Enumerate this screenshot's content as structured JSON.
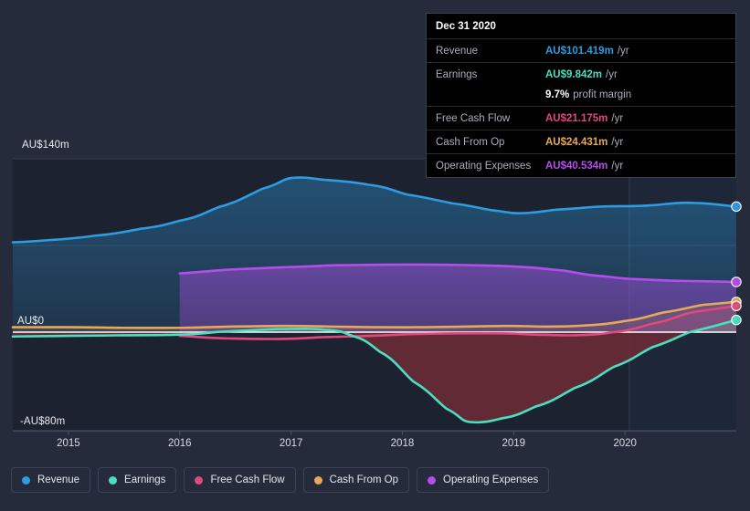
{
  "chart_data": {
    "type": "area",
    "title": "",
    "xlabel": "",
    "ylabel": "",
    "currency": "AU$",
    "grid": true,
    "legend_position": "bottom",
    "x_tick_labels": [
      "2015",
      "2016",
      "2017",
      "2018",
      "2019",
      "2020"
    ],
    "y_tick_labels": [
      "AU$140m",
      "AU$0",
      "-AU$80m"
    ],
    "ylim": [
      -80,
      140
    ],
    "xlim": [
      2014.5,
      2021.0
    ],
    "series": [
      {
        "name": "Revenue",
        "color": "#2e9ce0",
        "x": [
          2014.5,
          2014.85,
          2015.25,
          2015.65,
          2016.0,
          2016.35,
          2016.75,
          2017.0,
          2017.3,
          2017.7,
          2018.05,
          2018.45,
          2018.8,
          2019.05,
          2019.4,
          2019.8,
          2020.15,
          2020.55,
          2021.0
        ],
        "values": [
          72.5,
          74.5,
          78.0,
          83.5,
          90.0,
          101.0,
          116.0,
          124.5,
          123.0,
          119.0,
          111.0,
          104.0,
          98.5,
          96.0,
          99.0,
          101.5,
          102.0,
          104.5,
          101.419
        ]
      },
      {
        "name": "Earnings",
        "color": "#4adfc0",
        "x": [
          2014.5,
          2015.0,
          2015.5,
          2016.0,
          2016.4,
          2016.9,
          2017.3,
          2017.55,
          2017.8,
          2018.1,
          2018.4,
          2018.6,
          2018.9,
          2019.2,
          2019.55,
          2019.9,
          2020.25,
          2020.6,
          2021.0
        ],
        "values": [
          -3.5,
          -3.0,
          -2.5,
          -2.0,
          0.5,
          2.5,
          2.0,
          -3.0,
          -16.0,
          -40.0,
          -62.0,
          -72.5,
          -69.5,
          -60.0,
          -45.0,
          -28.0,
          -12.0,
          0.5,
          9.842
        ]
      },
      {
        "name": "Free Cash Flow",
        "color": "#e0487e",
        "x": [
          2016.0,
          2016.4,
          2016.9,
          2017.3,
          2017.7,
          2018.1,
          2018.5,
          2018.9,
          2019.2,
          2019.55,
          2019.9,
          2020.25,
          2020.6,
          2021.0
        ],
        "values": [
          -3.0,
          -5.0,
          -5.5,
          -4.0,
          -3.0,
          -1.5,
          -1.0,
          -1.0,
          -2.0,
          -2.5,
          0.0,
          7.0,
          16.0,
          21.175
        ]
      },
      {
        "name": "Cash From Op",
        "color": "#e8a855",
        "x": [
          2014.5,
          2015.0,
          2015.5,
          2016.0,
          2016.45,
          2016.95,
          2017.35,
          2017.75,
          2018.15,
          2018.55,
          2018.95,
          2019.3,
          2019.65,
          2020.0,
          2020.35,
          2020.7,
          2021.0
        ],
        "values": [
          4.0,
          4.0,
          3.5,
          3.5,
          4.5,
          5.0,
          4.5,
          4.0,
          4.0,
          4.5,
          5.0,
          4.5,
          5.5,
          9.0,
          16.0,
          22.0,
          24.431
        ]
      },
      {
        "name": "Operating Expenses",
        "color": "#b44dea",
        "x": [
          2016.0,
          2016.45,
          2016.95,
          2017.4,
          2017.85,
          2018.25,
          2018.65,
          2019.0,
          2019.35,
          2019.7,
          2020.05,
          2020.45,
          2020.75,
          2021.0
        ],
        "values": [
          47.5,
          50.5,
          52.5,
          54.0,
          54.5,
          54.5,
          54.0,
          53.0,
          50.5,
          46.0,
          43.0,
          41.5,
          41.0,
          40.534
        ]
      }
    ]
  },
  "tooltip": {
    "title": "Dec 31 2020",
    "rows": [
      {
        "key": "Revenue",
        "value": "AU$101.419m",
        "suffix": "/yr",
        "color": "#2e9ce0"
      },
      {
        "key": "Earnings",
        "value": "AU$9.842m",
        "suffix": "/yr",
        "color": "#4adfc0"
      },
      {
        "key": "Free Cash Flow",
        "value": "AU$21.175m",
        "suffix": "/yr",
        "color": "#e0487e"
      },
      {
        "key": "Cash From Op",
        "value": "AU$24.431m",
        "suffix": "/yr",
        "color": "#e8a855"
      },
      {
        "key": "Operating Expenses",
        "value": "AU$40.534m",
        "suffix": "/yr",
        "color": "#b44dea"
      }
    ],
    "profit_margin_value": "9.7%",
    "profit_margin_label": "profit margin"
  },
  "legend": {
    "items": [
      {
        "label": "Revenue",
        "color": "#2e9ce0",
        "icon": "legend-dot-icon"
      },
      {
        "label": "Earnings",
        "color": "#4adfc0",
        "icon": "legend-dot-icon"
      },
      {
        "label": "Free Cash Flow",
        "color": "#e0487e",
        "icon": "legend-dot-icon"
      },
      {
        "label": "Cash From Op",
        "color": "#e8a855",
        "icon": "legend-dot-icon"
      },
      {
        "label": "Operating Expenses",
        "color": "#b44dea",
        "icon": "legend-dot-icon"
      }
    ]
  },
  "axes": {
    "y_labels": [
      {
        "text": "AU$140m",
        "value": 140
      },
      {
        "text": "AU$0",
        "value": 0
      },
      {
        "text": "-AU$80m",
        "value": -80
      }
    ],
    "x_labels": [
      {
        "text": "2015",
        "value": 2015
      },
      {
        "text": "2016",
        "value": 2016
      },
      {
        "text": "2017",
        "value": 2017
      },
      {
        "text": "2018",
        "value": 2018
      },
      {
        "text": "2019",
        "value": 2019
      },
      {
        "text": "2020",
        "value": 2020
      }
    ]
  },
  "theme": {
    "background": "#252b3b",
    "plot_background": "#1d2230",
    "forecast_background": "#1b2433",
    "grid_color": "#3d4454",
    "zero_line_color": "#ffffff",
    "text_color": "#e3e6ec",
    "muted_text_color": "#a9aeb8"
  }
}
